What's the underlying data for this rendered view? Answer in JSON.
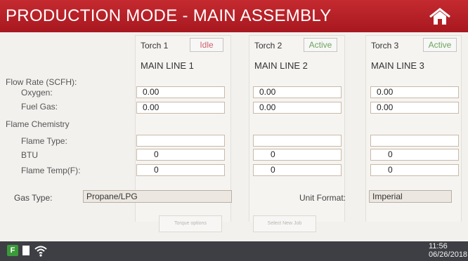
{
  "header": {
    "title": "PRODUCTION MODE - MAIN ASSEMBLY",
    "home_icon": "home-icon"
  },
  "torches": [
    {
      "name": "Torch 1",
      "status": "Idle",
      "line": "MAIN LINE 1",
      "oxygen": "0.00",
      "fuel_gas": "0.00",
      "flame_type": "",
      "btu": "0",
      "flame_temp": "0"
    },
    {
      "name": "Torch 2",
      "status": "Active",
      "line": "MAIN LINE 2",
      "oxygen": "0.00",
      "fuel_gas": "0.00",
      "flame_type": "",
      "btu": "0",
      "flame_temp": "0"
    },
    {
      "name": "Torch 3",
      "status": "Active",
      "line": "MAIN LINE 3",
      "oxygen": "0.00",
      "fuel_gas": "0.00",
      "flame_type": "",
      "btu": "0",
      "flame_temp": "0"
    }
  ],
  "labels": {
    "flow_rate": "Flow Rate (SCFH):",
    "oxygen": "Oxygen:",
    "fuel_gas": "Fuel Gas:",
    "flame_chemistry": "Flame Chemistry",
    "flame_type": "Flame Type:",
    "btu": "BTU",
    "flame_temp": "Flame Temp(F):"
  },
  "bottom": {
    "gas_type_label": "Gas Type:",
    "gas_type_value": "Propane/LPG",
    "unit_format_label": "Unit Format:",
    "unit_format_value": "Imperial",
    "button1": "Torque options",
    "button2": "Select New Job"
  },
  "footer": {
    "f_label": "F",
    "time": "11:56",
    "date": "06/26/2018"
  },
  "colors": {
    "header": "#b31f25",
    "idle": "#d0606b",
    "active": "#6ea35b",
    "footer": "#3e3f44"
  }
}
